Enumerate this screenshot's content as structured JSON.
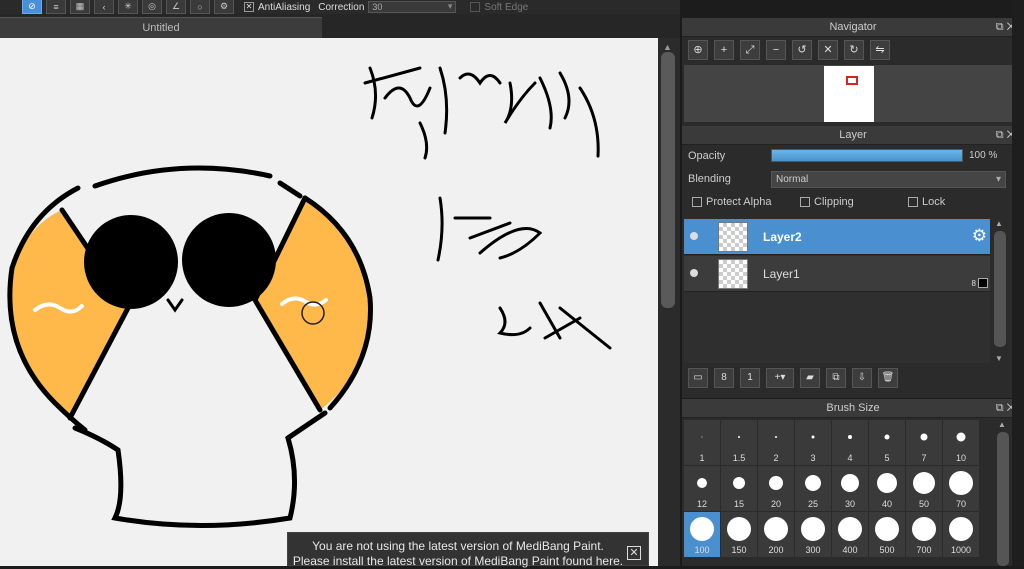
{
  "toolbar": {
    "antialiasing_label": "AntiAliasing",
    "correction_label": "Correction",
    "correction_value": "30",
    "soft_edge_label": "Soft Edge"
  },
  "document": {
    "tab_title": "Untitled"
  },
  "canvas": {
    "background": "#f1f1f1",
    "accent_fill": "#ffb84a"
  },
  "notice": {
    "line1": "You are not using the latest version of MediBang Paint.",
    "line2": "Please install the latest version of MediBang Paint found here."
  },
  "navigator": {
    "title": "Navigator",
    "tools": [
      "zoom-fit-icon",
      "zoom-in-icon",
      "fit-window-icon",
      "zoom-out-icon",
      "rotate-left-icon",
      "reset-view-icon",
      "rotate-right-icon",
      "flip-icon"
    ]
  },
  "layer_panel": {
    "title": "Layer",
    "opacity_label": "Opacity",
    "opacity_value": "100 %",
    "opacity_fraction": 1.0,
    "blending_label": "Blending",
    "blending_value": "Normal",
    "protect_alpha_label": "Protect Alpha",
    "clipping_label": "Clipping",
    "lock_label": "Lock",
    "layers": [
      {
        "name": "Layer2",
        "selected": true
      },
      {
        "name": "Layer1",
        "selected": false,
        "badge": "8"
      }
    ]
  },
  "brush_panel": {
    "title": "Brush Size",
    "sizes": [
      "1",
      "1.5",
      "2",
      "3",
      "4",
      "5",
      "7",
      "10",
      "12",
      "15",
      "20",
      "25",
      "30",
      "40",
      "50",
      "70",
      "100",
      "150",
      "200",
      "300",
      "400",
      "500",
      "700",
      "1000"
    ],
    "selected": "100"
  }
}
